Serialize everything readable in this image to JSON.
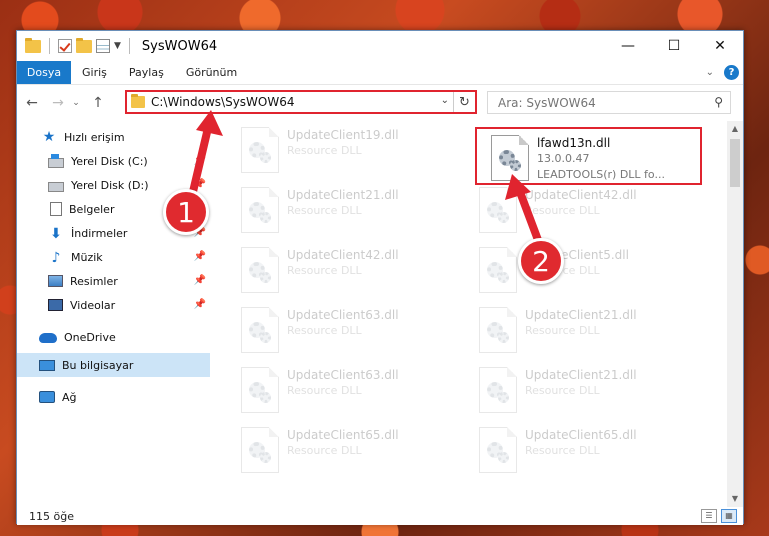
{
  "window": {
    "title": "SysWOW64"
  },
  "ribbon": {
    "tabs": [
      "Dosya",
      "Giriş",
      "Paylaş",
      "Görünüm"
    ]
  },
  "nav": {
    "address": "C:\\Windows\\SysWOW64",
    "search_placeholder": "Ara: SysWOW64"
  },
  "sidebar": {
    "items": [
      {
        "label": "Hızlı erişim",
        "icon": "star-icon"
      },
      {
        "label": "Yerel Disk (C:)",
        "icon": "drive-c-icon"
      },
      {
        "label": "Yerel Disk (D:)",
        "icon": "drive-icon"
      },
      {
        "label": "Belgeler",
        "icon": "documents-icon"
      },
      {
        "label": "İndirmeler",
        "icon": "downloads-icon"
      },
      {
        "label": "Müzik",
        "icon": "music-icon"
      },
      {
        "label": "Resimler",
        "icon": "pictures-icon"
      },
      {
        "label": "Videolar",
        "icon": "videos-icon"
      },
      {
        "label": "OneDrive",
        "icon": "onedrive-icon"
      },
      {
        "label": "Bu bilgisayar",
        "icon": "this-pc-icon"
      },
      {
        "label": "Ağ",
        "icon": "network-icon"
      }
    ]
  },
  "files": {
    "highlighted": {
      "name": "lfawd13n.dll",
      "version": "13.0.0.47",
      "description": "LEADTOOLS(r) DLL fo..."
    },
    "left_column": [
      {
        "name": "UpdateClient19.dll",
        "type": "Resource DLL"
      },
      {
        "name": "UpdateClient21.dll",
        "type": "Resource DLL"
      },
      {
        "name": "UpdateClient42.dll",
        "type": "Resource DLL"
      },
      {
        "name": "UpdateClient63.dll",
        "type": "Resource DLL"
      },
      {
        "name": "UpdateClient63.dll",
        "type": "Resource DLL"
      },
      {
        "name": "UpdateClient65.dll",
        "type": "Resource DLL"
      }
    ],
    "right_column": [
      {
        "name": "UpdateClient42.dll",
        "type": "Resource DLL"
      },
      {
        "name": "UpdateClient5.dll",
        "type": "Resource DLL"
      },
      {
        "name": "UpdateClient21.dll",
        "type": "Resource DLL"
      },
      {
        "name": "UpdateClient21.dll",
        "type": "Resource DLL"
      },
      {
        "name": "UpdateClient65.dll",
        "type": "Resource DLL"
      }
    ]
  },
  "status": {
    "item_count": "115 öğe"
  },
  "annotations": {
    "step1": "1",
    "step2": "2",
    "accent": "#e0242f"
  }
}
